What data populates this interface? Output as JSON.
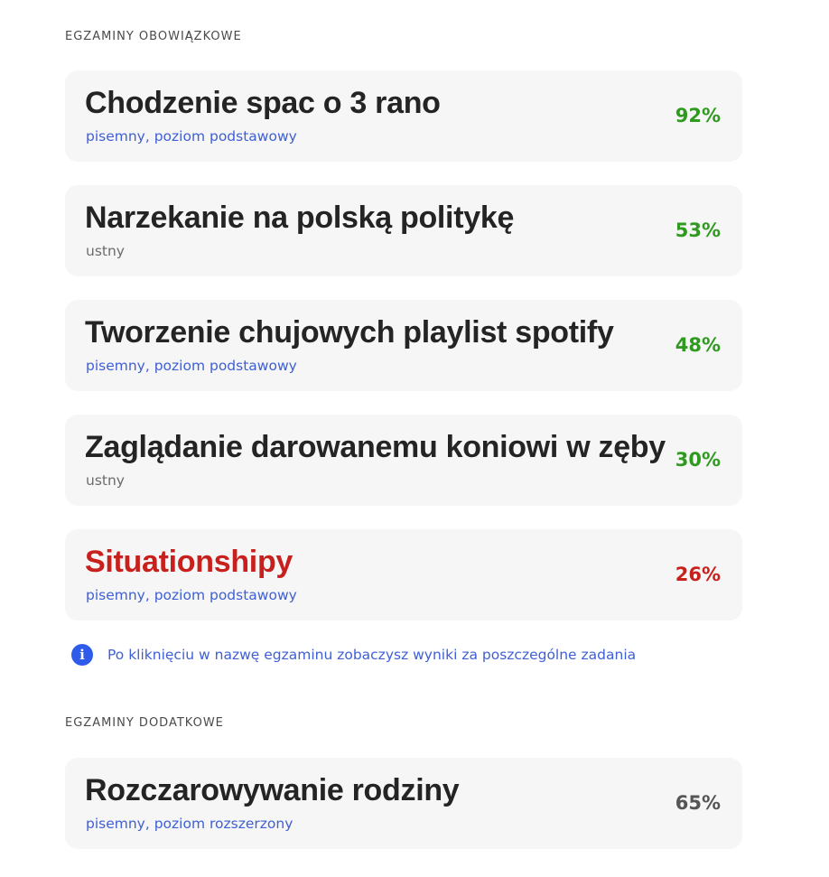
{
  "sections": {
    "mandatory_heading": "EGZAMINY OBOWIĄZKOWE",
    "additional_heading": "EGZAMINY DODATKOWE"
  },
  "mandatory_exams": [
    {
      "title": "Chodzenie spac o 3 rano",
      "subtitle": "pisemny, poziom podstawowy",
      "score": "92%",
      "score_color": "#2f9a1f",
      "title_color": "#242424"
    },
    {
      "title": "Narzekanie na polską politykę",
      "subtitle": "ustny",
      "score": "53%",
      "score_color": "#2f9a1f",
      "title_color": "#242424"
    },
    {
      "title": "Tworzenie chujowych playlist spotify",
      "subtitle": "pisemny, poziom podstawowy",
      "score": "48%",
      "score_color": "#2f9a1f",
      "title_color": "#242424"
    },
    {
      "title": "Zaglądanie darowanemu koniowi w zęby",
      "subtitle": "ustny",
      "score": "30%",
      "score_color": "#2f9a1f",
      "title_color": "#242424"
    },
    {
      "title": "Situationshipy",
      "subtitle": "pisemny, poziom podstawowy",
      "score": "26%",
      "score_color": "#c8201c",
      "title_color": "#c8201c"
    }
  ],
  "info": {
    "icon": "info-icon",
    "text": "Po kliknięciu w nazwę egzaminu zobaczysz wyniki za poszczególne zadania"
  },
  "additional_exams": [
    {
      "title": "Rozczarowywanie rodziny",
      "subtitle": "pisemny, poziom rozszerzony",
      "score": "65%",
      "score_color": "#555555",
      "title_color": "#242424"
    }
  ]
}
